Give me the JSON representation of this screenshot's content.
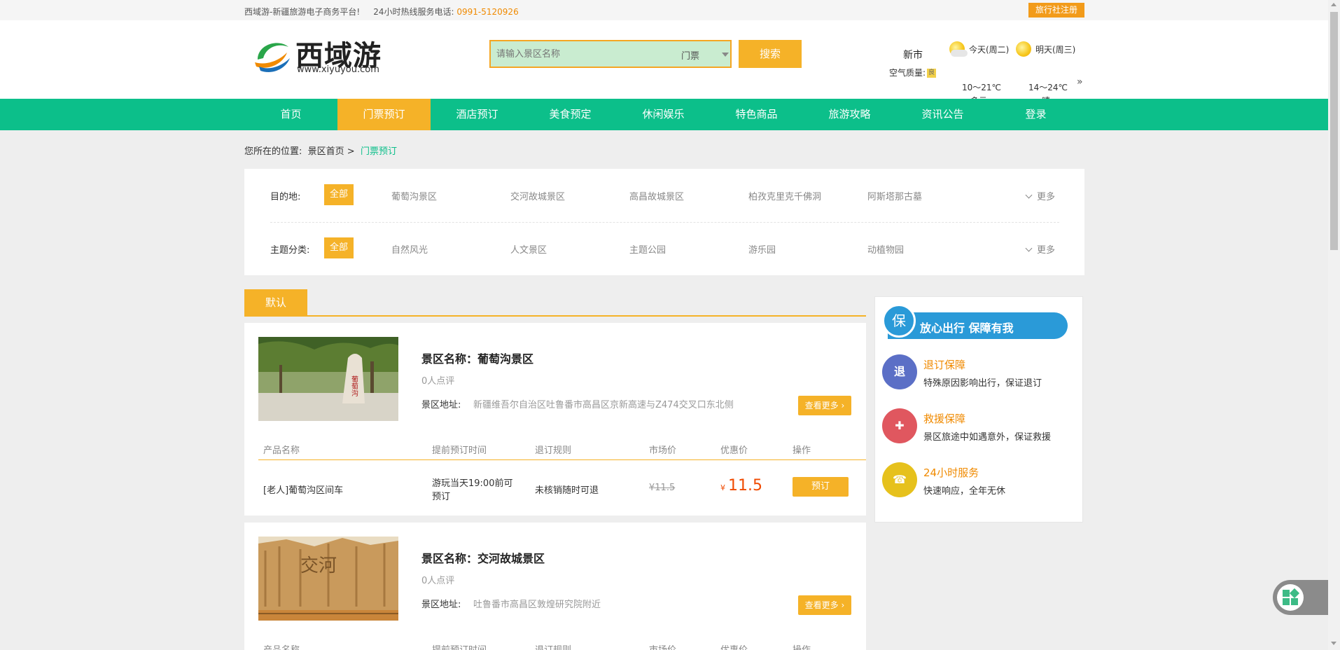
{
  "topbar": {
    "slogan": "西域游-新疆旅游电子商务平台!",
    "hotline_label": "24小时热线服务电话:",
    "hotline_number": "0991-5120926",
    "agency_register": "旅行社注册"
  },
  "header": {
    "logo_text": "西域游",
    "logo_url": "www.xiyuyou.com",
    "search_placeholder": "请输入景区名称",
    "search_type": "门票",
    "search_button": "搜索",
    "city": "新市",
    "air_quality_label": "空气质量:",
    "air_quality_value": "良",
    "weather": [
      {
        "label": "今天(周二)",
        "temp": "10～21℃",
        "cond": "多云"
      },
      {
        "label": "明天(周三)",
        "temp": "14～24℃",
        "cond": "晴"
      }
    ],
    "weather_more": "»"
  },
  "nav": [
    "首页",
    "门票预订",
    "酒店预订",
    "美食预定",
    "休闲娱乐",
    "特色商品",
    "旅游攻略",
    "资讯公告",
    "登录"
  ],
  "breadcrumb": {
    "prefix": "您所在的位置:",
    "home": "景区首页 >",
    "current": "门票预订"
  },
  "filters": {
    "destination": {
      "label": "目的地:",
      "all": "全部",
      "options": [
        "葡萄沟景区",
        "交河故城景区",
        "高昌故城景区",
        "柏孜克里克千佛洞",
        "阿斯塔那古墓"
      ],
      "more": "更多"
    },
    "theme": {
      "label": "主题分类:",
      "all": "全部",
      "options": [
        "自然风光",
        "人文景区",
        "主题公园",
        "游乐园",
        "动植物园"
      ],
      "more": "更多"
    }
  },
  "sort_tab": "默认",
  "table_headers": [
    "产品名称",
    "提前预订时间",
    "退订规则",
    "市场价",
    "优惠价",
    "操作"
  ],
  "scenic_list": [
    {
      "name": "景区名称：葡萄沟景区",
      "reviews": "0人点评",
      "address_label": "景区地址:",
      "address": "新疆维吾尔自治区吐鲁番市高昌区京新高速与Z474交叉口东北侧",
      "more_button": "查看更多",
      "thumb_text": "葡萄沟",
      "product": {
        "name": "[老人]葡萄沟区间车",
        "advance_line1": "游玩当天19:00前可",
        "advance_line2": "预订",
        "refund": "未核销随时可退",
        "market_price": "¥11.5",
        "currency": "¥",
        "price": "11.5",
        "book": "预订"
      }
    },
    {
      "name": "景区名称：交河故城景区",
      "reviews": "0人点评",
      "address_label": "景区地址:",
      "address": "吐鲁番市高昌区敦煌研究院附近",
      "more_button": "查看更多",
      "thumb_text": "交河"
    }
  ],
  "guarantee": {
    "banner": "放心出行  保障有我",
    "shield": "保",
    "items": [
      {
        "icon": "退",
        "title": "退订保障",
        "desc": "特殊原因影响出行，保证退订",
        "color": "#5b6fc6"
      },
      {
        "icon": "✚",
        "title": "救援保障",
        "desc": "景区旅途中如遇意外，保证救援",
        "color": "#e0575f"
      },
      {
        "icon": "☎",
        "title": "24小时服务",
        "desc": "快速响应，全年无休",
        "color": "#e6c11c"
      }
    ]
  },
  "colors": {
    "accent": "#f5b228",
    "nav_green": "#0cbf8a",
    "price_red": "#f04a00"
  }
}
